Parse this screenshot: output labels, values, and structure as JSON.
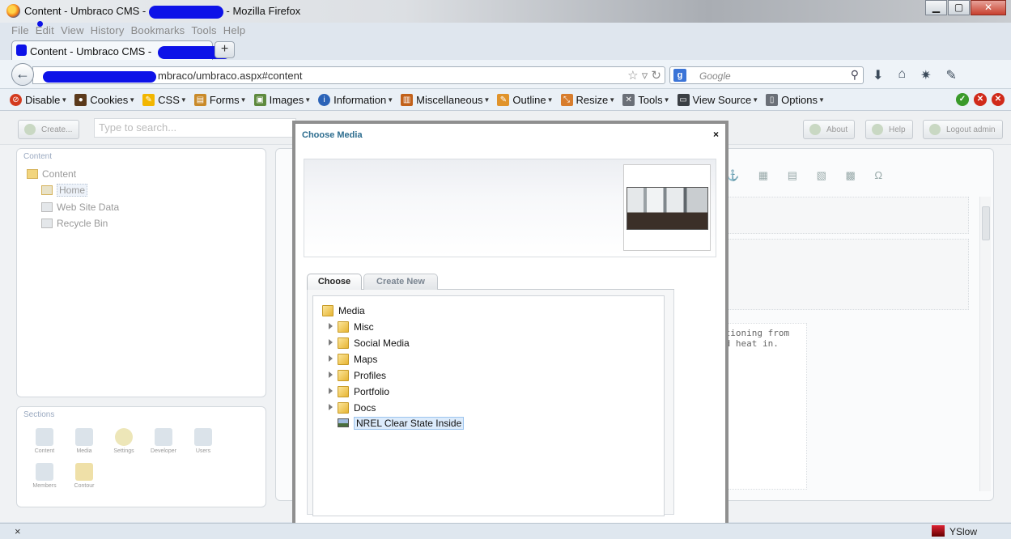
{
  "window": {
    "title_prefix": "Content - Umbraco CMS -",
    "title_suffix": "- Mozilla Firefox",
    "minimize": "▁",
    "maximize": "▢",
    "close": "✕"
  },
  "menu": [
    "File",
    "Edit",
    "View",
    "History",
    "Bookmarks",
    "Tools",
    "Help"
  ],
  "tab": {
    "label": "Content - Umbraco CMS -",
    "new_tab": "+"
  },
  "navbar": {
    "back": "←",
    "url_visible": "mbraco/umbraco.aspx#content",
    "url_icons": "☆ ▿ ↻",
    "search_engine": "g",
    "search_placeholder": "Google",
    "search_icon": "⚲"
  },
  "devbar": {
    "items": [
      "Disable",
      "Cookies",
      "CSS",
      "Forms",
      "Images",
      "Information",
      "Miscellaneous",
      "Outline",
      "Resize",
      "Tools",
      "View Source",
      "Options"
    ],
    "colors": [
      "#d33a1e",
      "#5b3a1c",
      "#f2b600",
      "#c98a2a",
      "#5e8a3e",
      "#2b63b8",
      "#c2611a",
      "#e0932b",
      "#d87d2d",
      "#6a6f77",
      "#3a3f44",
      "#6a6f77"
    ]
  },
  "umbraco": {
    "create_btn": "Create...",
    "search_placeholder": "Type to search...",
    "about_btn": "About",
    "help_btn": "Help",
    "logout_btn": "Logout admin",
    "content_panel_title": "Content",
    "tree": [
      "Content",
      "Home",
      "Web Site Data",
      "Recycle Bin"
    ],
    "sections_title": "Sections",
    "sections": [
      "Content",
      "Media",
      "Settings",
      "Developer",
      "Users",
      "Members",
      "Contour"
    ],
    "editor_text_line1": "itioning from",
    "editor_text_line2": "nd heat in.",
    "editor_toolbar": "⚓ ▦ ▤ ▧ ▩ Ω"
  },
  "modal": {
    "title": "Choose Media",
    "close": "×",
    "tabs": {
      "choose": "Choose",
      "create_new": "Create New"
    },
    "root": "Media",
    "folders": [
      "Misc",
      "Social Media",
      "Maps",
      "Profiles",
      "Portfolio",
      "Docs"
    ],
    "selected_item": "NREL Clear State Inside"
  },
  "statusbar": {
    "close": "×",
    "yslow": "YSlow"
  }
}
